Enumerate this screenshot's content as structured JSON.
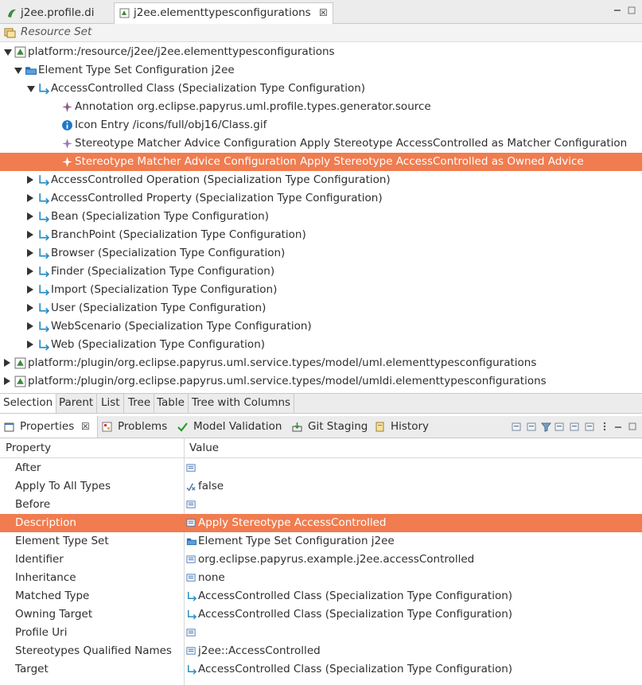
{
  "editor_tabs": [
    {
      "label": "j2ee.profile.di"
    },
    {
      "label": "j2ee.elementtypesconfigurations"
    }
  ],
  "resource_set_label": "Resource Set",
  "tree": [
    {
      "text": "platform:/resource/j2ee/j2ee.elementtypesconfigurations",
      "level": 0,
      "expander": "expanded",
      "icon": "resource-icon"
    },
    {
      "text": "Element Type Set Configuration j2ee",
      "level": 1,
      "expander": "expanded",
      "icon": "folder-icon"
    },
    {
      "text": "AccessControlled Class (Specialization Type Configuration)",
      "level": 2,
      "expander": "expanded",
      "icon": "specialization-icon"
    },
    {
      "text": "Annotation org.eclipse.papyrus.uml.profile.types.generator.source",
      "level": 3,
      "expander": "none",
      "icon": "annotation-icon"
    },
    {
      "text": "Icon Entry /icons/full/obj16/Class.gif",
      "level": 3,
      "expander": "none",
      "icon": "info-icon"
    },
    {
      "text": "Stereotype Matcher Advice Configuration Apply Stereotype AccessControlled as Matcher Configuration",
      "level": 3,
      "expander": "none",
      "icon": "advice-icon"
    },
    {
      "text": "Stereotype Matcher Advice Configuration Apply Stereotype AccessControlled as Owned Advice",
      "level": 3,
      "expander": "none",
      "icon": "advice-icon",
      "selected": true
    },
    {
      "text": "AccessControlled Operation (Specialization Type Configuration)",
      "level": 2,
      "expander": "collapsed",
      "icon": "specialization-icon"
    },
    {
      "text": "AccessControlled Property (Specialization Type Configuration)",
      "level": 2,
      "expander": "collapsed",
      "icon": "specialization-icon"
    },
    {
      "text": "Bean (Specialization Type Configuration)",
      "level": 2,
      "expander": "collapsed",
      "icon": "specialization-icon"
    },
    {
      "text": "BranchPoint (Specialization Type Configuration)",
      "level": 2,
      "expander": "collapsed",
      "icon": "specialization-icon"
    },
    {
      "text": "Browser (Specialization Type Configuration)",
      "level": 2,
      "expander": "collapsed",
      "icon": "specialization-icon"
    },
    {
      "text": "Finder (Specialization Type Configuration)",
      "level": 2,
      "expander": "collapsed",
      "icon": "specialization-icon"
    },
    {
      "text": "Import (Specialization Type Configuration)",
      "level": 2,
      "expander": "collapsed",
      "icon": "specialization-icon"
    },
    {
      "text": "User (Specialization Type Configuration)",
      "level": 2,
      "expander": "collapsed",
      "icon": "specialization-icon"
    },
    {
      "text": "WebScenario (Specialization Type Configuration)",
      "level": 2,
      "expander": "collapsed",
      "icon": "specialization-icon"
    },
    {
      "text": "Web (Specialization Type Configuration)",
      "level": 2,
      "expander": "collapsed",
      "icon": "specialization-icon"
    },
    {
      "text": "platform:/plugin/org.eclipse.papyrus.uml.service.types/model/uml.elementtypesconfigurations",
      "level": 0,
      "expander": "collapsed",
      "icon": "resource-icon"
    },
    {
      "text": "platform:/plugin/org.eclipse.papyrus.uml.service.types/model/umldi.elementtypesconfigurations",
      "level": 0,
      "expander": "collapsed",
      "icon": "resource-icon"
    }
  ],
  "tree_tabs": [
    "Selection",
    "Parent",
    "List",
    "Tree",
    "Table",
    "Tree with Columns"
  ],
  "views": [
    {
      "label": "Properties",
      "icon": "properties-icon"
    },
    {
      "label": "Problems",
      "icon": "problems-icon"
    },
    {
      "label": "Model Validation",
      "icon": "checkmark-icon"
    },
    {
      "label": "Git Staging",
      "icon": "git-staging-icon"
    },
    {
      "label": "History",
      "icon": "history-icon"
    }
  ],
  "properties": {
    "header_property": "Property",
    "header_value": "Value",
    "rows": [
      {
        "name": "After",
        "value": "",
        "icon": "list-icon"
      },
      {
        "name": "Apply To All Types",
        "value": "false",
        "icon": "boolean-icon"
      },
      {
        "name": "Before",
        "value": "",
        "icon": "list-icon"
      },
      {
        "name": "Description",
        "value": "Apply Stereotype AccessControlled",
        "icon": "list-icon",
        "selected": true
      },
      {
        "name": "Element Type Set",
        "value": "Element Type Set Configuration j2ee",
        "icon": "folder-icon"
      },
      {
        "name": "Identifier",
        "value": "org.eclipse.papyrus.example.j2ee.accessControlled",
        "icon": "list-icon"
      },
      {
        "name": "Inheritance",
        "value": "none",
        "icon": "list-icon"
      },
      {
        "name": "Matched Type",
        "value": "AccessControlled Class (Specialization Type Configuration)",
        "icon": "specialization-icon"
      },
      {
        "name": "Owning Target",
        "value": "AccessControlled Class (Specialization Type Configuration)",
        "icon": "specialization-icon"
      },
      {
        "name": "Profile Uri",
        "value": "",
        "icon": "list-icon"
      },
      {
        "name": "Stereotypes Qualified Names",
        "value": "j2ee::AccessControlled",
        "icon": "list-icon"
      },
      {
        "name": "Target",
        "value": "AccessControlled Class (Specialization Type Configuration)",
        "icon": "specialization-icon"
      }
    ]
  },
  "colors": {
    "selection": "#f07c4f",
    "specialization": "#2a8fc4",
    "folder": "#1f6fb0"
  }
}
